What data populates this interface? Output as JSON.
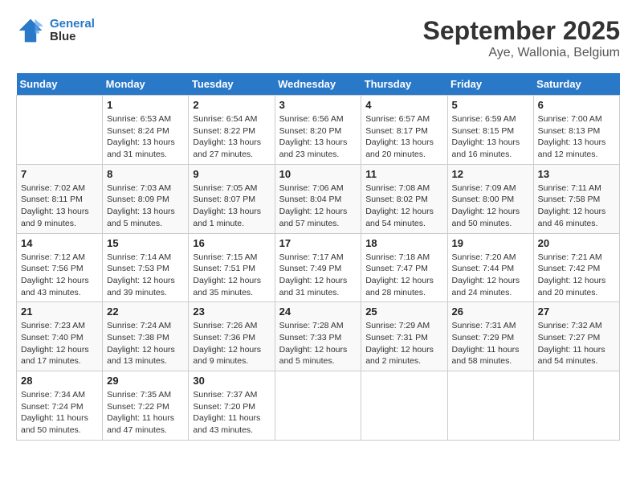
{
  "header": {
    "logo_line1": "General",
    "logo_line2": "Blue",
    "title": "September 2025",
    "subtitle": "Aye, Wallonia, Belgium"
  },
  "columns": [
    "Sunday",
    "Monday",
    "Tuesday",
    "Wednesday",
    "Thursday",
    "Friday",
    "Saturday"
  ],
  "weeks": [
    [
      {
        "num": "",
        "info": ""
      },
      {
        "num": "1",
        "info": "Sunrise: 6:53 AM\nSunset: 8:24 PM\nDaylight: 13 hours\nand 31 minutes."
      },
      {
        "num": "2",
        "info": "Sunrise: 6:54 AM\nSunset: 8:22 PM\nDaylight: 13 hours\nand 27 minutes."
      },
      {
        "num": "3",
        "info": "Sunrise: 6:56 AM\nSunset: 8:20 PM\nDaylight: 13 hours\nand 23 minutes."
      },
      {
        "num": "4",
        "info": "Sunrise: 6:57 AM\nSunset: 8:17 PM\nDaylight: 13 hours\nand 20 minutes."
      },
      {
        "num": "5",
        "info": "Sunrise: 6:59 AM\nSunset: 8:15 PM\nDaylight: 13 hours\nand 16 minutes."
      },
      {
        "num": "6",
        "info": "Sunrise: 7:00 AM\nSunset: 8:13 PM\nDaylight: 13 hours\nand 12 minutes."
      }
    ],
    [
      {
        "num": "7",
        "info": "Sunrise: 7:02 AM\nSunset: 8:11 PM\nDaylight: 13 hours\nand 9 minutes."
      },
      {
        "num": "8",
        "info": "Sunrise: 7:03 AM\nSunset: 8:09 PM\nDaylight: 13 hours\nand 5 minutes."
      },
      {
        "num": "9",
        "info": "Sunrise: 7:05 AM\nSunset: 8:07 PM\nDaylight: 13 hours\nand 1 minute."
      },
      {
        "num": "10",
        "info": "Sunrise: 7:06 AM\nSunset: 8:04 PM\nDaylight: 12 hours\nand 57 minutes."
      },
      {
        "num": "11",
        "info": "Sunrise: 7:08 AM\nSunset: 8:02 PM\nDaylight: 12 hours\nand 54 minutes."
      },
      {
        "num": "12",
        "info": "Sunrise: 7:09 AM\nSunset: 8:00 PM\nDaylight: 12 hours\nand 50 minutes."
      },
      {
        "num": "13",
        "info": "Sunrise: 7:11 AM\nSunset: 7:58 PM\nDaylight: 12 hours\nand 46 minutes."
      }
    ],
    [
      {
        "num": "14",
        "info": "Sunrise: 7:12 AM\nSunset: 7:56 PM\nDaylight: 12 hours\nand 43 minutes."
      },
      {
        "num": "15",
        "info": "Sunrise: 7:14 AM\nSunset: 7:53 PM\nDaylight: 12 hours\nand 39 minutes."
      },
      {
        "num": "16",
        "info": "Sunrise: 7:15 AM\nSunset: 7:51 PM\nDaylight: 12 hours\nand 35 minutes."
      },
      {
        "num": "17",
        "info": "Sunrise: 7:17 AM\nSunset: 7:49 PM\nDaylight: 12 hours\nand 31 minutes."
      },
      {
        "num": "18",
        "info": "Sunrise: 7:18 AM\nSunset: 7:47 PM\nDaylight: 12 hours\nand 28 minutes."
      },
      {
        "num": "19",
        "info": "Sunrise: 7:20 AM\nSunset: 7:44 PM\nDaylight: 12 hours\nand 24 minutes."
      },
      {
        "num": "20",
        "info": "Sunrise: 7:21 AM\nSunset: 7:42 PM\nDaylight: 12 hours\nand 20 minutes."
      }
    ],
    [
      {
        "num": "21",
        "info": "Sunrise: 7:23 AM\nSunset: 7:40 PM\nDaylight: 12 hours\nand 17 minutes."
      },
      {
        "num": "22",
        "info": "Sunrise: 7:24 AM\nSunset: 7:38 PM\nDaylight: 12 hours\nand 13 minutes."
      },
      {
        "num": "23",
        "info": "Sunrise: 7:26 AM\nSunset: 7:36 PM\nDaylight: 12 hours\nand 9 minutes."
      },
      {
        "num": "24",
        "info": "Sunrise: 7:28 AM\nSunset: 7:33 PM\nDaylight: 12 hours\nand 5 minutes."
      },
      {
        "num": "25",
        "info": "Sunrise: 7:29 AM\nSunset: 7:31 PM\nDaylight: 12 hours\nand 2 minutes."
      },
      {
        "num": "26",
        "info": "Sunrise: 7:31 AM\nSunset: 7:29 PM\nDaylight: 11 hours\nand 58 minutes."
      },
      {
        "num": "27",
        "info": "Sunrise: 7:32 AM\nSunset: 7:27 PM\nDaylight: 11 hours\nand 54 minutes."
      }
    ],
    [
      {
        "num": "28",
        "info": "Sunrise: 7:34 AM\nSunset: 7:24 PM\nDaylight: 11 hours\nand 50 minutes."
      },
      {
        "num": "29",
        "info": "Sunrise: 7:35 AM\nSunset: 7:22 PM\nDaylight: 11 hours\nand 47 minutes."
      },
      {
        "num": "30",
        "info": "Sunrise: 7:37 AM\nSunset: 7:20 PM\nDaylight: 11 hours\nand 43 minutes."
      },
      {
        "num": "",
        "info": ""
      },
      {
        "num": "",
        "info": ""
      },
      {
        "num": "",
        "info": ""
      },
      {
        "num": "",
        "info": ""
      }
    ]
  ]
}
